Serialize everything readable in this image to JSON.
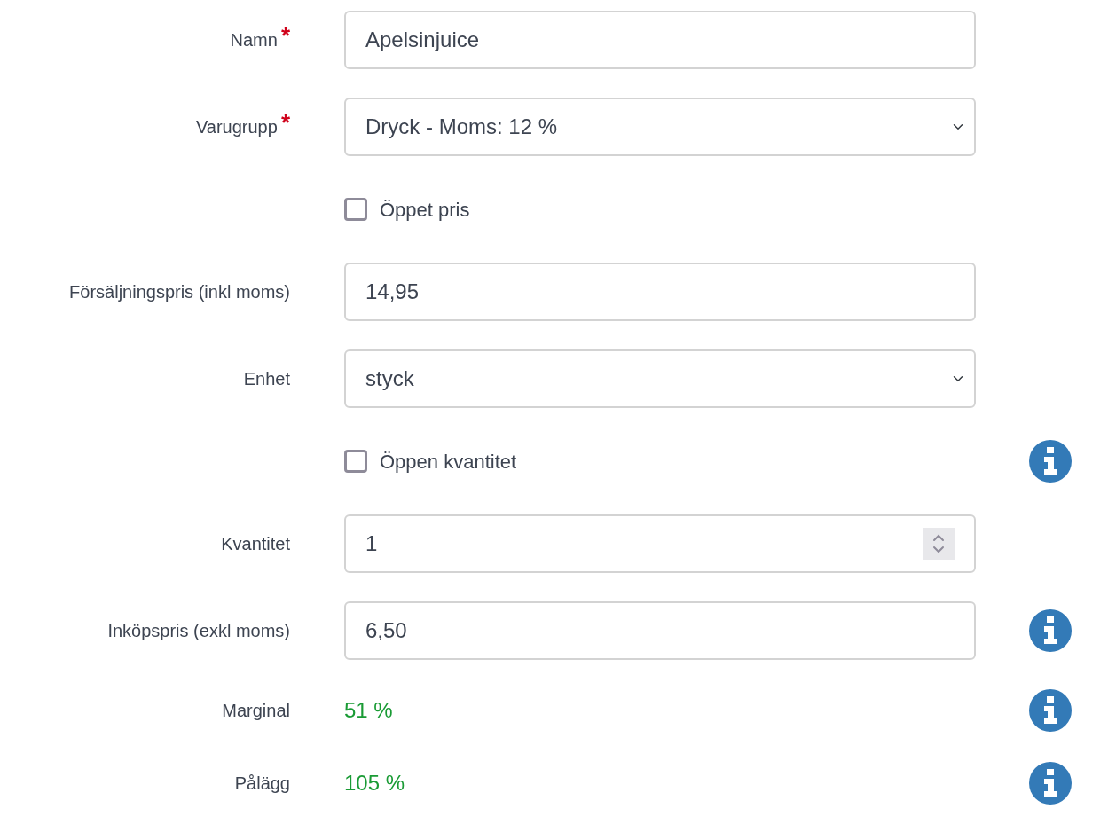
{
  "fields": [
    {
      "kind": "text",
      "label": "Namn",
      "required_mark": "*",
      "value": "Apelsinjuice",
      "info": false
    },
    {
      "kind": "select",
      "label": "Varugrupp",
      "required_mark": "*",
      "value": "Dryck - Moms: 12 %",
      "info": false
    },
    {
      "kind": "checkbox",
      "label": "Öppet pris",
      "checked": false,
      "info": false
    },
    {
      "kind": "text",
      "label": "Försäljningspris (inkl moms)",
      "value": "14,95",
      "info": false
    },
    {
      "kind": "select",
      "label": "Enhet",
      "value": "styck",
      "info": false
    },
    {
      "kind": "checkbox",
      "label": "Öppen kvantitet",
      "checked": false,
      "info": true
    },
    {
      "kind": "number",
      "label": "Kvantitet",
      "value": "1",
      "info": false
    },
    {
      "kind": "text",
      "label": "Inköpspris (exkl moms)",
      "value": "6,50",
      "info": true
    },
    {
      "kind": "readout",
      "label": "Marginal",
      "value": "51 %",
      "info": true
    },
    {
      "kind": "readout",
      "label": "Pålägg",
      "value": "105 %",
      "info": true
    }
  ]
}
